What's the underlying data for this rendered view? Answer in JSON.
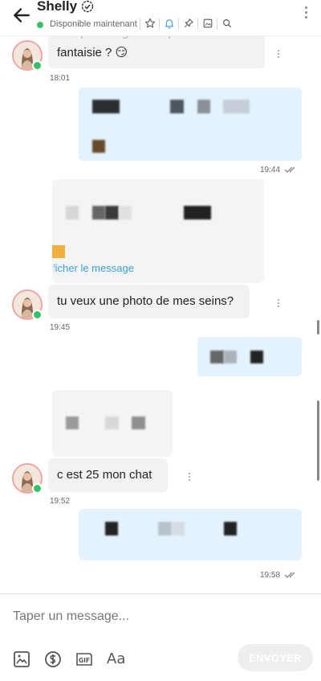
{
  "header": {
    "name": "Shelly",
    "status": "Disponible maintenant"
  },
  "messages": [
    {
      "type": "incoming",
      "text_line1": "Vos plus longues ou petite tenue",
      "text_line2": "fantaisie ? 😏",
      "time": "18:01"
    },
    {
      "type": "outgoing-media",
      "time": "19:44",
      "read": true
    },
    {
      "type": "incoming-media",
      "link": "Afficher le message"
    },
    {
      "type": "incoming",
      "text": "tu veux une photo de mes seins?",
      "time": "19:45"
    },
    {
      "type": "outgoing-media"
    },
    {
      "type": "incoming-media"
    },
    {
      "type": "incoming",
      "text": "c est 25 mon chat",
      "time": "19:52"
    },
    {
      "type": "outgoing-media",
      "time": "19:58",
      "read": true
    }
  ],
  "composer": {
    "placeholder": "Taper un message...",
    "text_format": "Aa",
    "send_label": "ENVOYER"
  },
  "colors": {
    "accent": "#3aa0d8",
    "online": "#37c26a",
    "bubble_in": "#f2f2f2",
    "bubble_out": "#e3f2fc"
  },
  "icons": [
    "arrow-left-icon",
    "verified-icon",
    "star-icon",
    "bell-icon",
    "pin-icon",
    "image-icon",
    "search-icon",
    "more-vertical-icon",
    "gallery-icon",
    "dollar-icon",
    "gif-icon"
  ]
}
